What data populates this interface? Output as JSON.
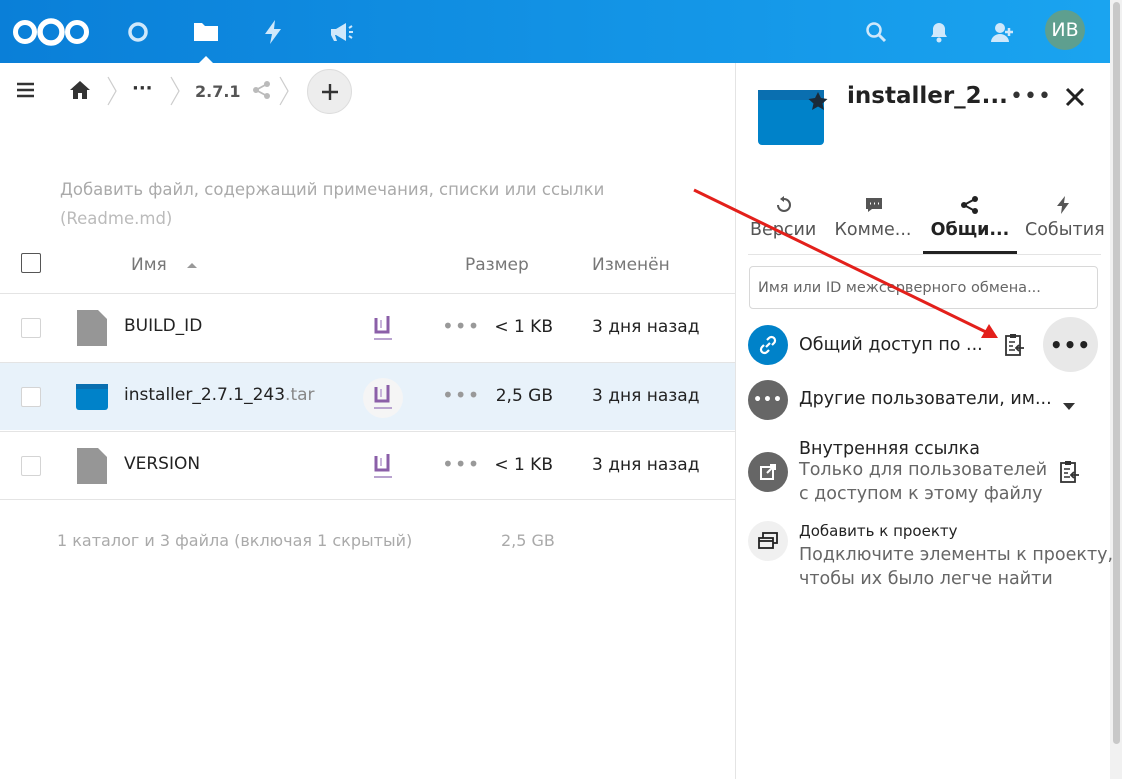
{
  "colors": {
    "topbar": "#0a82dc",
    "accent": "#0082c9",
    "folder_blue": "#0082c9",
    "annotation_arrow": "#e3201b"
  },
  "header": {
    "logo": "nextcloud-logo-icon",
    "apps": [
      "dashboard-icon",
      "files-icon",
      "activity-icon",
      "announcements-icon"
    ],
    "right": [
      "search-icon",
      "notifications-icon",
      "contacts-icon"
    ],
    "avatar_initials": "ИВ"
  },
  "breadcrumb": {
    "ellipsis": "···",
    "current": "2.7.1"
  },
  "readme": {
    "line1": "Добавить файл, содержащий примечания, списки или ссылки",
    "line2": "(Readme.md)"
  },
  "table": {
    "headers": {
      "name": "Имя",
      "size": "Размер",
      "modified": "Изменён"
    },
    "rows": [
      {
        "name": "BUILD_ID",
        "ext": "",
        "size": "< 1 KB",
        "modified": "3 дня назад",
        "selected": false
      },
      {
        "name": "installer_2.7.1_243",
        "ext": ".tar",
        "size": "2,5 GB",
        "modified": "3 дня назад",
        "selected": true
      },
      {
        "name": "VERSION",
        "ext": "",
        "size": "< 1 KB",
        "modified": "3 дня назад",
        "selected": false
      }
    ],
    "summary": "1 каталог и 3 файла (включая 1 скрытый)",
    "summary_size": "2,5 GB"
  },
  "sidebar": {
    "title": "installer_2...",
    "tabs": [
      {
        "label": "Версии",
        "icon": "history-icon"
      },
      {
        "label": "Комме...",
        "icon": "comment-icon"
      },
      {
        "label": "Общи...",
        "icon": "share-icon",
        "active": true
      },
      {
        "label": "События",
        "icon": "activity-icon"
      }
    ],
    "share_placeholder": "Имя или ID межсерверного обмена...",
    "public_link": "Общий доступ по ...",
    "other_users": "Другие пользователи, им...",
    "internal_link": {
      "title": "Внутренняя ссылка",
      "line1": "Только для пользователей",
      "line2": "с доступом к этому файлу"
    },
    "project": {
      "title": "Добавить к проекту",
      "line1": "Подключите элементы к проекту,",
      "line2": "чтобы их было легче найти"
    }
  }
}
